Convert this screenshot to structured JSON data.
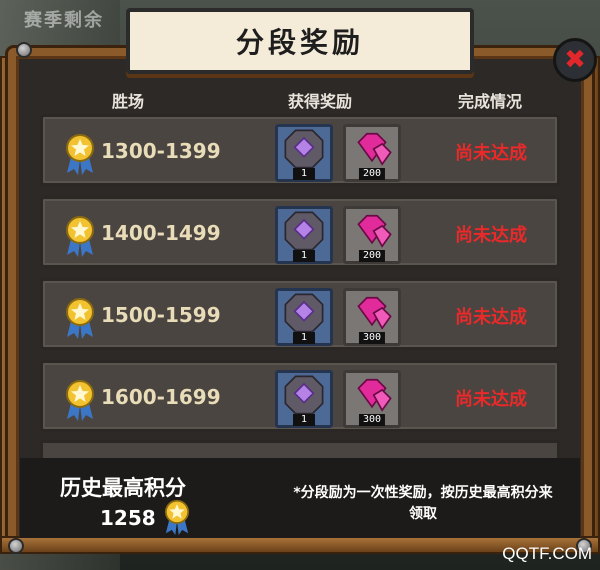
{
  "background": {
    "title": "赛季剩余"
  },
  "dialog": {
    "title": "分段奖励",
    "headers": {
      "wins": "胜场",
      "rewards": "获得奖励",
      "status": "完成情况"
    },
    "rows": [
      {
        "range": "1300-1399",
        "chip_qty": "1",
        "gem_qty": "200",
        "status": "尚未达成"
      },
      {
        "range": "1400-1499",
        "chip_qty": "1",
        "gem_qty": "200",
        "status": "尚未达成"
      },
      {
        "range": "1500-1599",
        "chip_qty": "1",
        "gem_qty": "300",
        "status": "尚未达成"
      },
      {
        "range": "1600-1699",
        "chip_qty": "1",
        "gem_qty": "300",
        "status": "尚未达成"
      }
    ],
    "footer": {
      "history_label": "历史最高积分",
      "history_score": "1258",
      "note": "*分段励为一次性奖励，按历史最高积分来领取"
    }
  },
  "icons": {
    "close": "close-icon",
    "medal": "medal-icon",
    "chip": "chip-icon",
    "gem": "gem-icon"
  },
  "colors": {
    "status": "#e9292a",
    "wood": "#8a5a2b",
    "plaque": "#f4ecd8"
  },
  "watermark": "QQTF.COM"
}
